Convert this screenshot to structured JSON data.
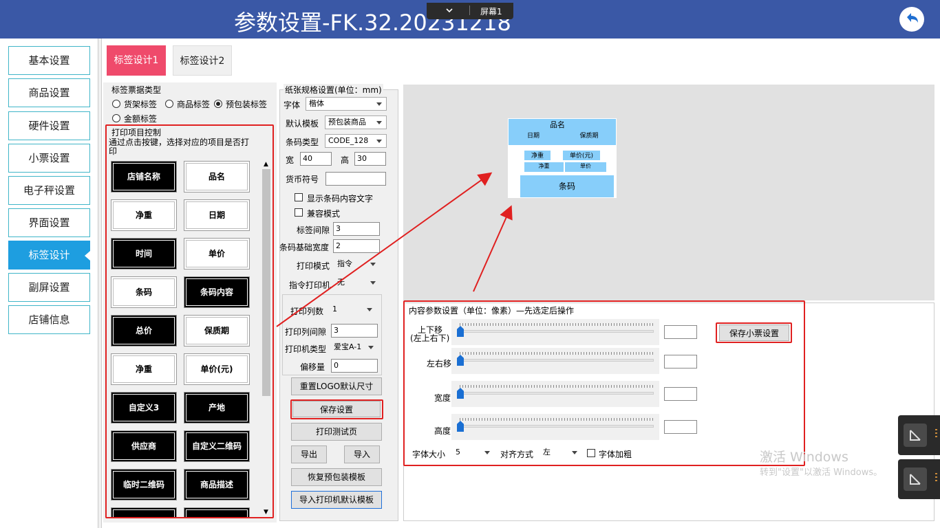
{
  "header": {
    "title": "参数设置-FK.32.20231218",
    "screen_label": "屏幕1",
    "back_icon": "undo-arrow-icon",
    "accent": "#3a58a6"
  },
  "sidebar": {
    "items": [
      {
        "label": "基本设置"
      },
      {
        "label": "商品设置"
      },
      {
        "label": "硬件设置"
      },
      {
        "label": "小票设置"
      },
      {
        "label": "电子秤设置"
      },
      {
        "label": "界面设置"
      },
      {
        "label": "标签设计",
        "active": true
      },
      {
        "label": "副屏设置"
      },
      {
        "label": "店铺信息"
      }
    ]
  },
  "tabs": [
    {
      "label": "标签设计1",
      "active": true
    },
    {
      "label": "标签设计2"
    }
  ],
  "ticket_type": {
    "title": "标签票据类型",
    "options": [
      {
        "label": "货架标签",
        "checked": false
      },
      {
        "label": "商品标签",
        "checked": false
      },
      {
        "label": "预包装标签",
        "checked": true
      },
      {
        "label": "金额标签",
        "checked": false
      }
    ]
  },
  "print_control": {
    "title": "打印项目控制",
    "hint": "通过点击按键，选择对应的项目是否打印",
    "items": [
      {
        "label": "店铺名称",
        "on": true
      },
      {
        "label": "品名",
        "on": false
      },
      {
        "label": "净重",
        "on": false
      },
      {
        "label": "日期",
        "on": false
      },
      {
        "label": "时间",
        "on": true
      },
      {
        "label": "单价",
        "on": false
      },
      {
        "label": "条码",
        "on": false
      },
      {
        "label": "条码内容",
        "on": true
      },
      {
        "label": "总价",
        "on": true
      },
      {
        "label": "保质期",
        "on": false
      },
      {
        "label": "净重",
        "on": false
      },
      {
        "label": "单价(元)",
        "on": false
      },
      {
        "label": "自定义3",
        "on": true
      },
      {
        "label": "产地",
        "on": true
      },
      {
        "label": "供应商",
        "on": true
      },
      {
        "label": "自定义二维码",
        "on": true
      },
      {
        "label": "临时二维码",
        "on": true
      },
      {
        "label": "商品描述",
        "on": true
      }
    ]
  },
  "paper": {
    "title": "纸张规格设置(单位：mm)",
    "font_label": "字体",
    "font_value": "楷体",
    "template_label": "默认模板",
    "template_value": "预包装商品",
    "barcode_type_label": "条码类型",
    "barcode_type_value": "CODE_128",
    "width_label": "宽",
    "width_value": "40",
    "height_label": "高",
    "height_value": "30",
    "currency_label": "货币符号",
    "currency_value": "",
    "show_barcode_text": "显示条码内容文字",
    "compat_mode": "兼容模式",
    "gap_label": "标签间隙",
    "gap_value": "3",
    "barcode_width_label": "条码基础宽度",
    "barcode_width_value": "2",
    "print_mode_label": "打印模式",
    "print_mode_value": "指令",
    "cmd_printer_label": "指令打印机",
    "cmd_printer_value": "无",
    "columns_label": "打印列数",
    "columns_value": "1",
    "col_gap_label": "打印列间隙",
    "col_gap_value": "3",
    "printer_type_label": "打印机类型",
    "printer_type_value": "爱宝A-1",
    "offset_label": "偏移量",
    "offset_value": "0",
    "btn_reset_logo": "重置LOGO默认尺寸",
    "btn_save": "保存设置",
    "btn_test": "打印测试页",
    "btn_export": "导出",
    "btn_import": "导入",
    "btn_restore": "恢复预包装模板",
    "btn_import_printer": "导入打印机默认模板"
  },
  "label_preview": {
    "name": "品名",
    "date": "日期",
    "shelf": "保质期",
    "weight": "净重",
    "unit_price": "单价(元)",
    "weight2": "净重",
    "price2": "单价",
    "barcode": "条码",
    "cell_color": "#87cefa"
  },
  "content_params": {
    "title": "内容参数设置（单位：像素）—先选定后操作",
    "up_down": "上下移",
    "up_down_sub": "(左上右下)",
    "left_right": "左右移",
    "width": "宽度",
    "height": "高度",
    "up_down_value": 0,
    "left_right_value": 0,
    "width_value": 0,
    "height_value": 0,
    "btn_save_ticket": "保存小票设置",
    "font_size_label": "字体大小",
    "font_size_value": "5",
    "align_label": "对齐方式",
    "align_value": "左",
    "bold_label": "字体加粗"
  },
  "watermark": {
    "line1": "激活 Windows",
    "line2": "转到\"设置\"以激活 Windows。"
  }
}
